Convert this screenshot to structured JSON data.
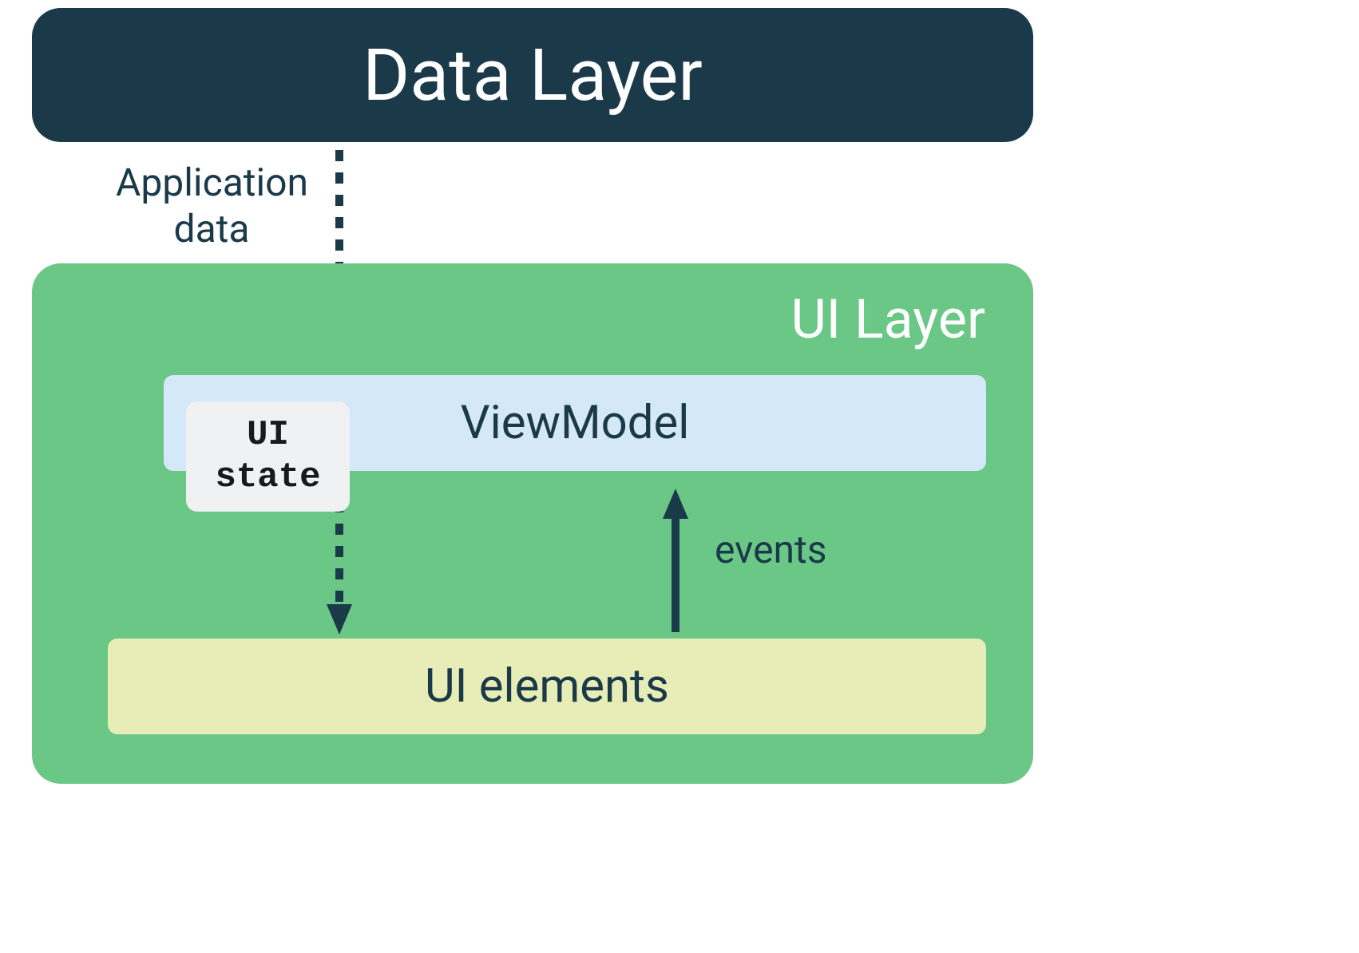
{
  "diagram": {
    "data_layer": {
      "label": "Data Layer"
    },
    "flow_labels": {
      "application_data": "Application\ndata",
      "events": "events"
    },
    "ui_layer": {
      "label": "UI Layer",
      "viewmodel": {
        "label": "ViewModel"
      },
      "ui_state": {
        "label": "UI\nstate"
      },
      "ui_elements": {
        "label": "UI elements"
      }
    },
    "colors": {
      "dark_blue": "#1a3a4a",
      "green": "#6bc785",
      "light_blue": "#d5e8f7",
      "light_yellow": "#e8edb8",
      "light_gray": "#f0f1f2"
    }
  }
}
